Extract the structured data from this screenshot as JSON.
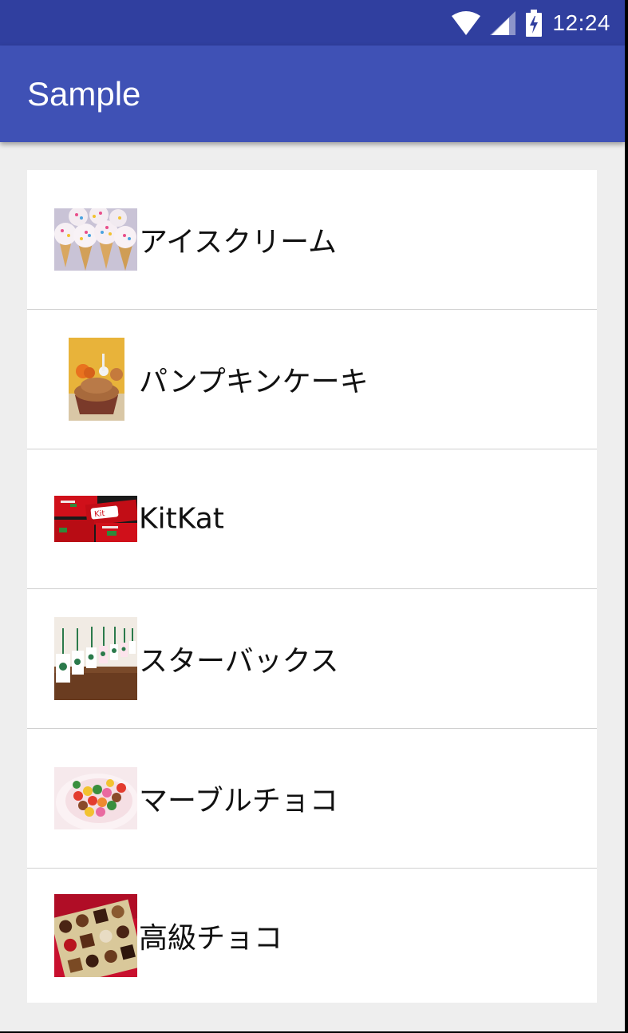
{
  "status_bar": {
    "time": "12:24",
    "icons": [
      "wifi-icon",
      "cell-signal-icon",
      "battery-charging-icon"
    ],
    "color": "#303f9f"
  },
  "app_bar": {
    "title": "Sample",
    "color": "#3f51b5"
  },
  "list": {
    "items": [
      {
        "label": "アイスクリーム",
        "image": "ice-cream-cones-photo"
      },
      {
        "label": "パンプキンケーキ",
        "image": "pumpkin-cupcake-photo"
      },
      {
        "label": "KitKat",
        "image": "kitkat-bars-photo"
      },
      {
        "label": "スターバックス",
        "image": "starbucks-cups-photo"
      },
      {
        "label": "マーブルチョコ",
        "image": "marble-chocolate-bowl-photo"
      },
      {
        "label": "高級チョコ",
        "image": "chocolate-box-photo"
      }
    ]
  }
}
